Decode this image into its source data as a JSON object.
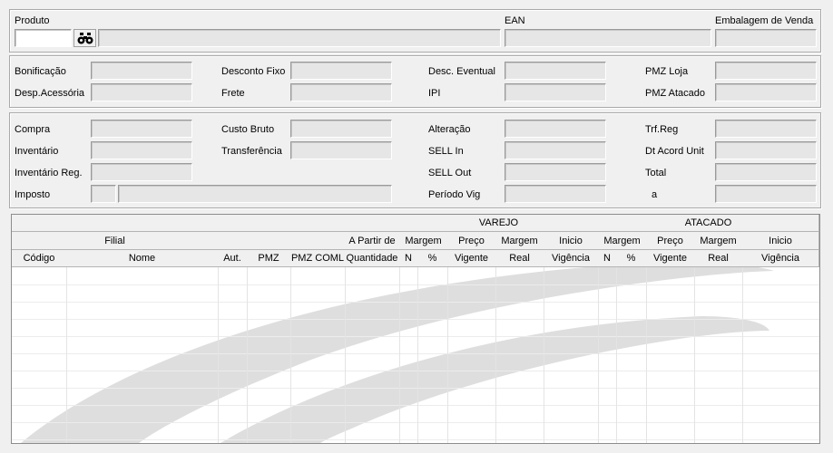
{
  "produto": {
    "label": "Produto",
    "code_value": "",
    "description_value": "",
    "ean_label": "EAN",
    "ean_value": "",
    "embalagem_label": "Embalagem de Venda",
    "embalagem_value": ""
  },
  "section2": {
    "bonificacao": "Bonificação",
    "desconto_fixo": "Desconto Fixo",
    "desc_eventual": "Desc. Eventual",
    "pmz_loja": "PMZ Loja",
    "desp_acessoria": "Desp.Acessória",
    "frete": "Frete",
    "ipi": "IPI",
    "pmz_atacado": "PMZ Atacado"
  },
  "section3": {
    "compra": "Compra",
    "custo_bruto": "Custo Bruto",
    "alteracao": "Alteração",
    "trf_reg": "Trf.Reg",
    "inventario": "Inventário",
    "transferencia": "Transferência",
    "sell_in": "SELL In",
    "dt_acord_unit": "Dt Acord Unit",
    "inventario_reg": "Inventário Reg.",
    "sell_out": "SELL Out",
    "total": "Total",
    "imposto": "Imposto",
    "periodo_vig": "Período Vig",
    "a": "a"
  },
  "grid": {
    "group_varejo": "VAREJO",
    "group_atacado": "ATACADO",
    "filial": "Filial",
    "a_partir_de": "A Partir de",
    "margem": "Margem",
    "preco": "Preço",
    "inicio": "Inicio",
    "codigo": "Código",
    "nome": "Nome",
    "aut": "Aut.",
    "pmz": "PMZ",
    "pmz_coml": "PMZ COML",
    "quantidade": "Quantidade",
    "n": "N",
    "pct": "%",
    "vigente": "Vigente",
    "real": "Real",
    "vigencia": "Vigência"
  },
  "icons": {
    "search": "binoculars-icon"
  }
}
